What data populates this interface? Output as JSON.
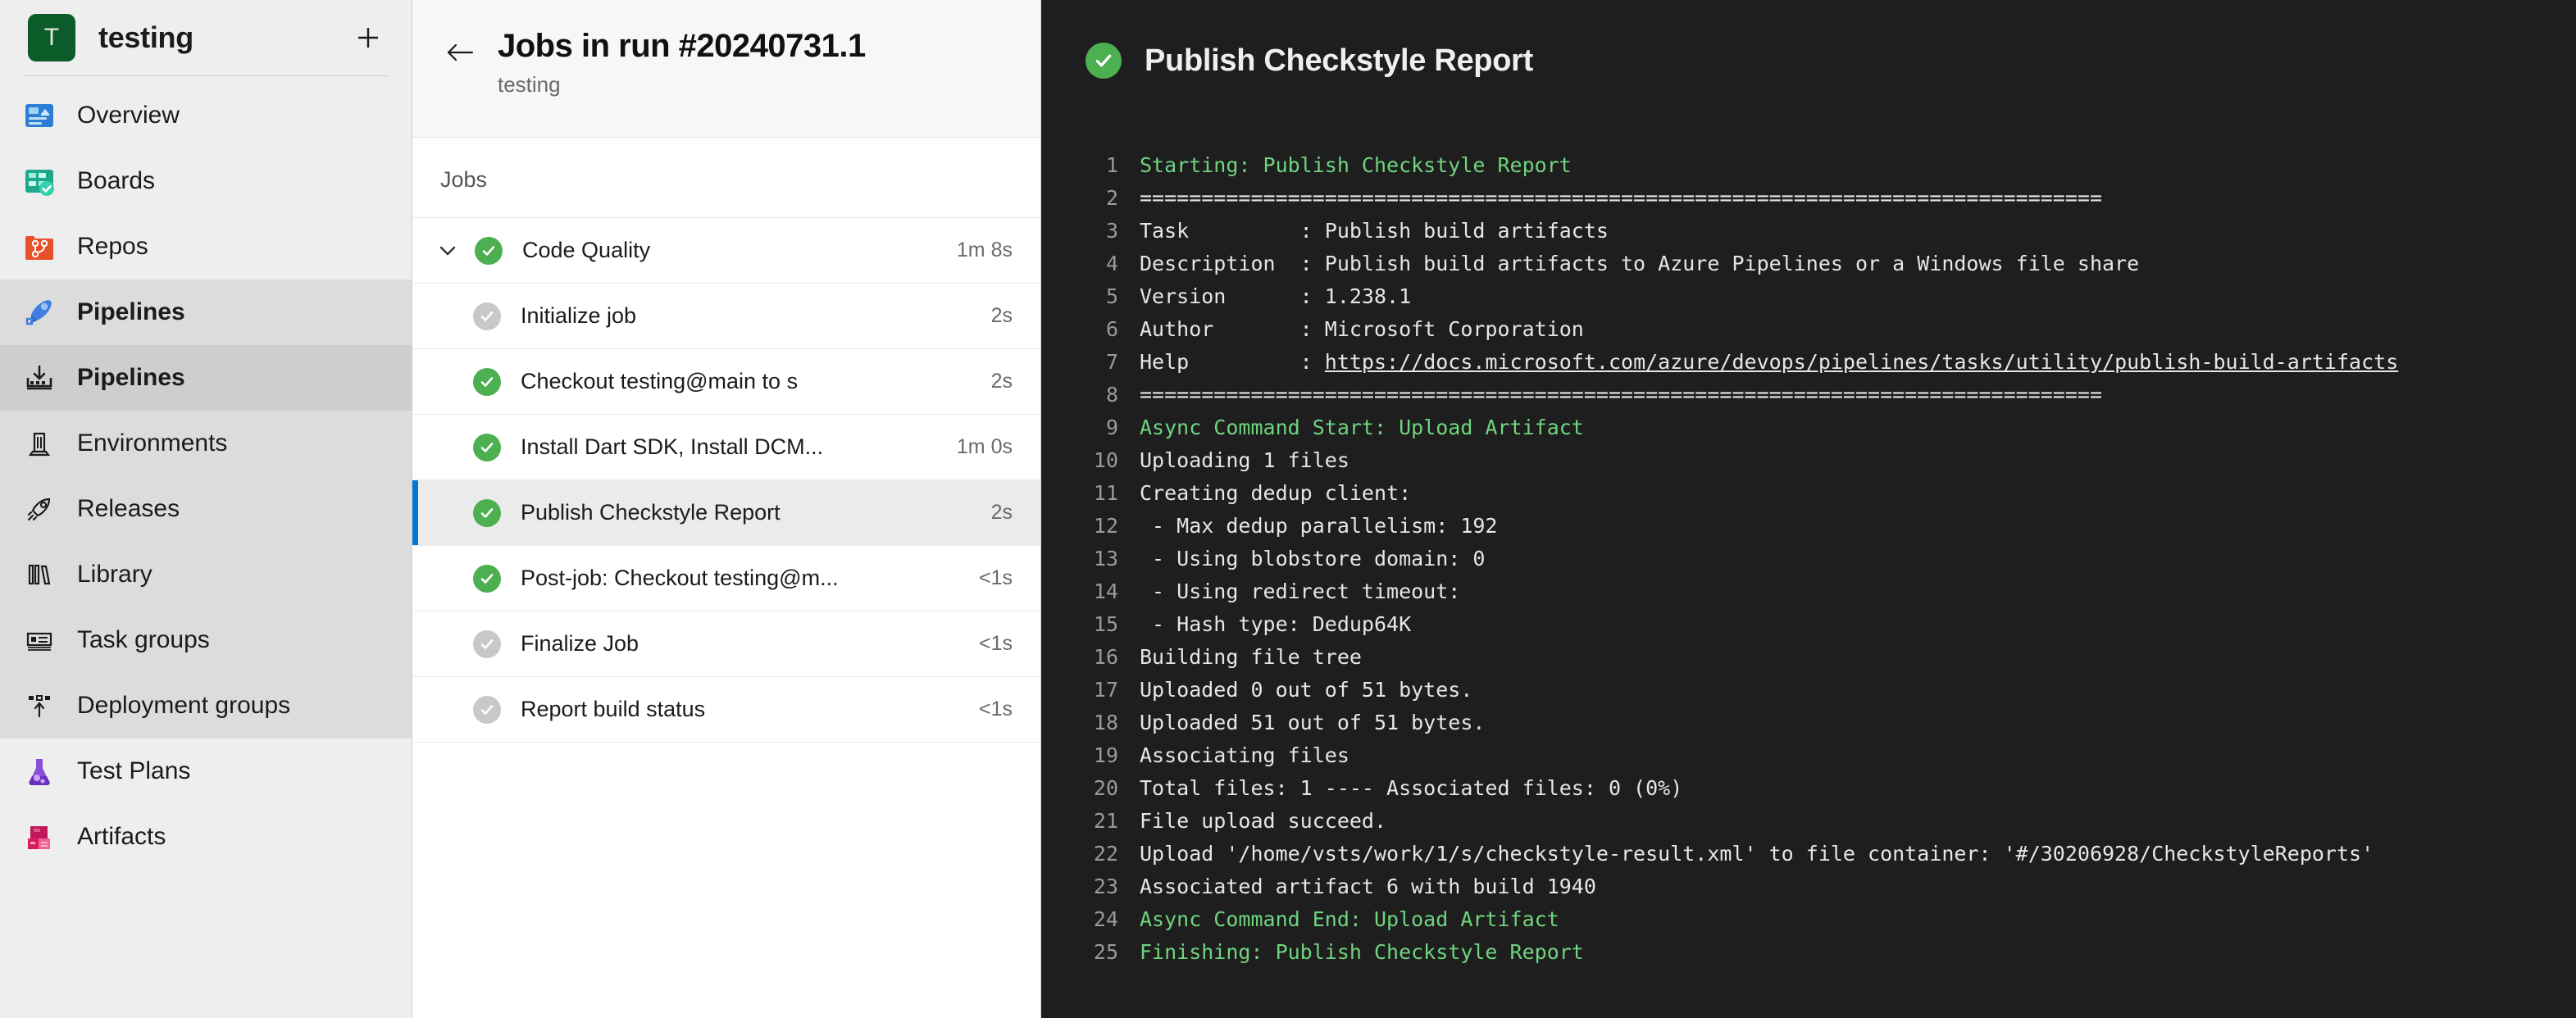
{
  "sidebar": {
    "project": {
      "initial": "T",
      "name": "testing",
      "add_label": "+"
    },
    "items": [
      {
        "label": "Overview",
        "icon": "overview-icon",
        "state": "normal"
      },
      {
        "label": "Boards",
        "icon": "boards-icon",
        "state": "normal"
      },
      {
        "label": "Repos",
        "icon": "repos-icon",
        "state": "normal"
      },
      {
        "label": "Pipelines",
        "icon": "pipelines-rocket-icon",
        "state": "group-head"
      },
      {
        "label": "Pipelines",
        "icon": "pipelines-runs-icon",
        "state": "selected"
      },
      {
        "label": "Environments",
        "icon": "environments-icon",
        "state": "group"
      },
      {
        "label": "Releases",
        "icon": "releases-icon",
        "state": "group"
      },
      {
        "label": "Library",
        "icon": "library-icon",
        "state": "group"
      },
      {
        "label": "Task groups",
        "icon": "task-groups-icon",
        "state": "group"
      },
      {
        "label": "Deployment groups",
        "icon": "deployment-groups-icon",
        "state": "group"
      },
      {
        "label": "Test Plans",
        "icon": "test-plans-icon",
        "state": "normal"
      },
      {
        "label": "Artifacts",
        "icon": "artifacts-icon",
        "state": "normal"
      }
    ]
  },
  "jobs_panel": {
    "back_label": "←",
    "title": "Jobs in run #20240731.1",
    "subtitle": "testing",
    "section_label": "Jobs",
    "rows": [
      {
        "name": "Code Quality",
        "duration": "1m 8s",
        "status": "pass",
        "level": "parent",
        "selected": false,
        "expanded": true
      },
      {
        "name": "Initialize job",
        "duration": "2s",
        "status": "skip",
        "level": "child",
        "selected": false
      },
      {
        "name": "Checkout testing@main to s",
        "duration": "2s",
        "status": "pass",
        "level": "child",
        "selected": false
      },
      {
        "name": "Install Dart SDK, Install DCM...",
        "duration": "1m 0s",
        "status": "pass",
        "level": "child",
        "selected": false
      },
      {
        "name": "Publish Checkstyle Report",
        "duration": "2s",
        "status": "pass",
        "level": "child",
        "selected": true
      },
      {
        "name": "Post-job: Checkout testing@m...",
        "duration": "<1s",
        "status": "pass",
        "level": "child",
        "selected": false
      },
      {
        "name": "Finalize Job",
        "duration": "<1s",
        "status": "skip",
        "level": "child",
        "selected": false
      },
      {
        "name": "Report build status",
        "duration": "<1s",
        "status": "skip",
        "level": "child",
        "selected": false
      }
    ]
  },
  "log_panel": {
    "title": "Publish Checkstyle Report",
    "status": "pass",
    "lines": [
      {
        "n": "1",
        "text": "Starting: Publish Checkstyle Report",
        "color": "green"
      },
      {
        "n": "2",
        "text": "==============================================================================",
        "color": "default"
      },
      {
        "n": "3",
        "text": "Task         : Publish build artifacts",
        "color": "default"
      },
      {
        "n": "4",
        "text": "Description  : Publish build artifacts to Azure Pipelines or a Windows file share",
        "color": "default"
      },
      {
        "n": "5",
        "text": "Version      : 1.238.1",
        "color": "default"
      },
      {
        "n": "6",
        "text": "Author       : Microsoft Corporation",
        "color": "default"
      },
      {
        "n": "7",
        "text": "Help         : ",
        "color": "default",
        "link": "https://docs.microsoft.com/azure/devops/pipelines/tasks/utility/publish-build-artifacts"
      },
      {
        "n": "8",
        "text": "==============================================================================",
        "color": "default"
      },
      {
        "n": "9",
        "text": "Async Command Start: Upload Artifact",
        "color": "green"
      },
      {
        "n": "10",
        "text": "Uploading 1 files",
        "color": "default"
      },
      {
        "n": "11",
        "text": "Creating dedup client:",
        "color": "default"
      },
      {
        "n": "12",
        "text": " - Max dedup parallelism: 192",
        "color": "default"
      },
      {
        "n": "13",
        "text": " - Using blobstore domain: 0",
        "color": "default"
      },
      {
        "n": "14",
        "text": " - Using redirect timeout:",
        "color": "default"
      },
      {
        "n": "15",
        "text": " - Hash type: Dedup64K",
        "color": "default"
      },
      {
        "n": "16",
        "text": "Building file tree",
        "color": "default"
      },
      {
        "n": "17",
        "text": "Uploaded 0 out of 51 bytes.",
        "color": "default"
      },
      {
        "n": "18",
        "text": "Uploaded 51 out of 51 bytes.",
        "color": "default"
      },
      {
        "n": "19",
        "text": "Associating files",
        "color": "default"
      },
      {
        "n": "20",
        "text": "Total files: 1 ---- Associated files: 0 (0%)",
        "color": "default"
      },
      {
        "n": "21",
        "text": "File upload succeed.",
        "color": "default"
      },
      {
        "n": "22",
        "text": "Upload '/home/vsts/work/1/s/checkstyle-result.xml' to file container: '#/30206928/CheckstyleReports'",
        "color": "default"
      },
      {
        "n": "23",
        "text": "Associated artifact 6 with build 1940",
        "color": "default"
      },
      {
        "n": "24",
        "text": "Async Command End: Upload Artifact",
        "color": "green"
      },
      {
        "n": "25",
        "text": "Finishing: Publish Checkstyle Report",
        "color": "green"
      }
    ]
  },
  "colors": {
    "accent": "#0078d4",
    "success": "#4caf50",
    "skipped": "#c8c8c8",
    "log_bg": "#1e1e1e",
    "log_green": "#6fd47e",
    "sidebar_bg": "#eeeeee"
  }
}
